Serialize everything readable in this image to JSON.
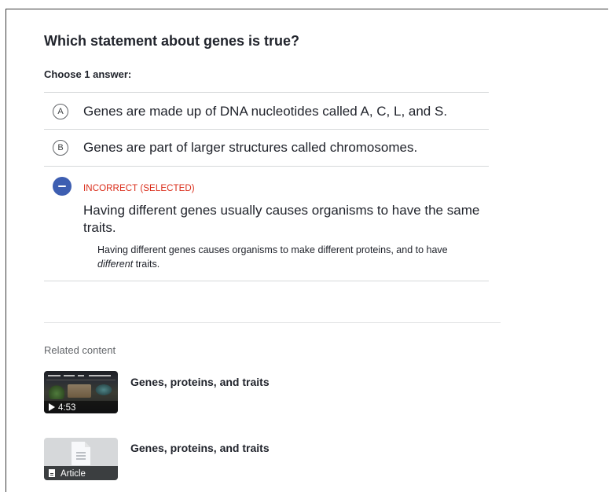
{
  "question": {
    "title": "Which statement about genes is true?",
    "instruction": "Choose 1 answer:"
  },
  "choices": [
    {
      "letter": "A",
      "text": "Genes are made up of DNA nucleotides called A, C, L, and S."
    },
    {
      "letter": "B",
      "text": "Genes are part of larger structures called chromosomes."
    }
  ],
  "selected_choice": {
    "status": "INCORRECT (SELECTED)",
    "text": "Having different genes usually causes organisms to have the same traits.",
    "rationale_start": "Having different genes causes organisms to make different proteins, and to have ",
    "rationale_emphasis": "different",
    "rationale_end": " traits."
  },
  "related": {
    "heading": "Related content",
    "items": [
      {
        "title": "Genes, proteins, and traits",
        "kind": "video",
        "duration": "4:53"
      },
      {
        "title": "Genes, proteins, and traits",
        "kind": "article",
        "badge": "Article"
      }
    ]
  },
  "colors": {
    "incorrect": "#d92916",
    "selected_icon": "#3d5eb1",
    "divider": "#d6d8da"
  }
}
